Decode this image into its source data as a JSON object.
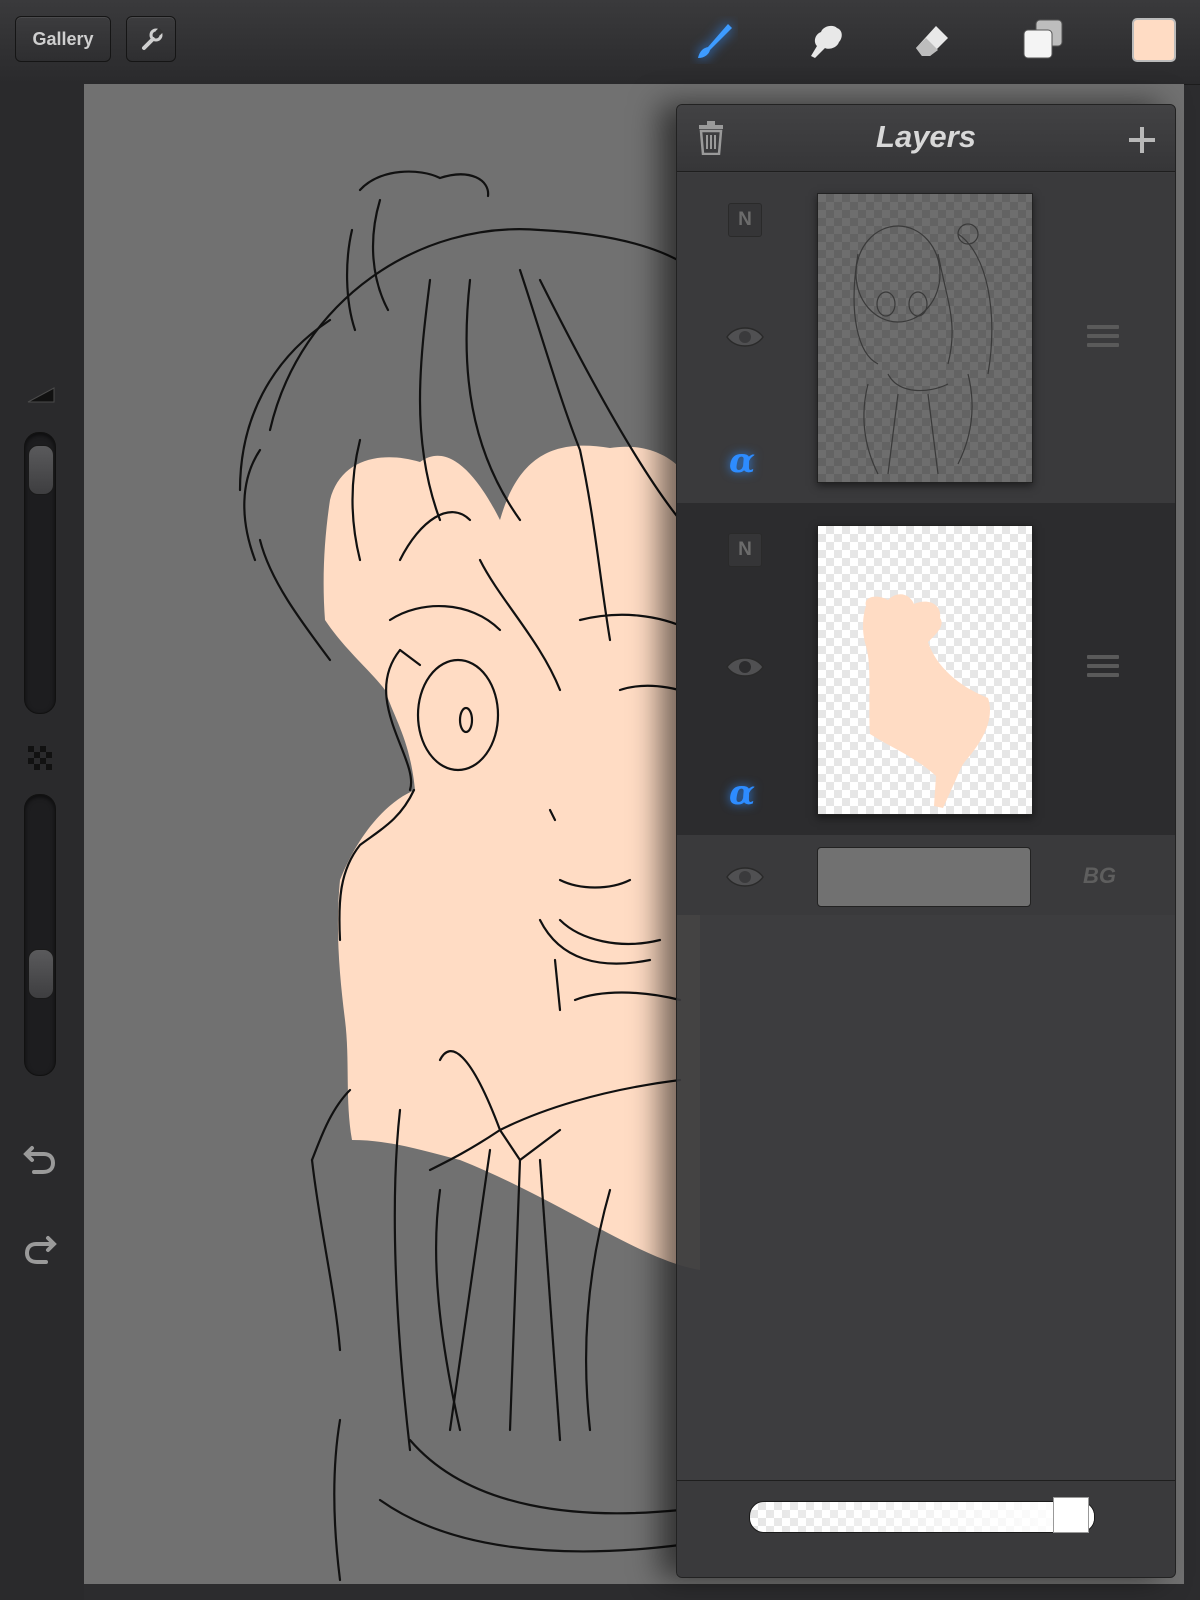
{
  "toolbar": {
    "gallery_label": "Gallery",
    "settings_icon": "wrench-icon",
    "tools": [
      {
        "name": "brush",
        "icon": "brush-icon",
        "active": true
      },
      {
        "name": "smudge",
        "icon": "smudge-icon",
        "active": false
      },
      {
        "name": "eraser",
        "icon": "eraser-icon",
        "active": false
      },
      {
        "name": "layers",
        "icon": "layers-icon",
        "active": true
      }
    ],
    "current_color": "#ffdcc4"
  },
  "sidebar": {
    "brush_size_level": 0.96,
    "brush_opacity_level": 0.33,
    "undo_icon": "undo-icon",
    "redo_icon": "redo-icon"
  },
  "layers_panel": {
    "title": "Layers",
    "delete_icon": "trash-icon",
    "add_icon": "plus-icon",
    "layers": [
      {
        "blend_badge": "N",
        "alpha_symbol": "α",
        "visible": true,
        "content": "lineart sketch",
        "selected": false
      },
      {
        "blend_badge": "N",
        "alpha_symbol": "α",
        "visible": true,
        "content": "skin fill",
        "selected": true
      }
    ],
    "background": {
      "label": "BG",
      "color": "#717171",
      "visible": true
    },
    "layer_opacity": 0.98
  },
  "colors": {
    "accent": "#2d8cff",
    "skin": "#ffdcc4",
    "canvas_bg": "#717171"
  }
}
